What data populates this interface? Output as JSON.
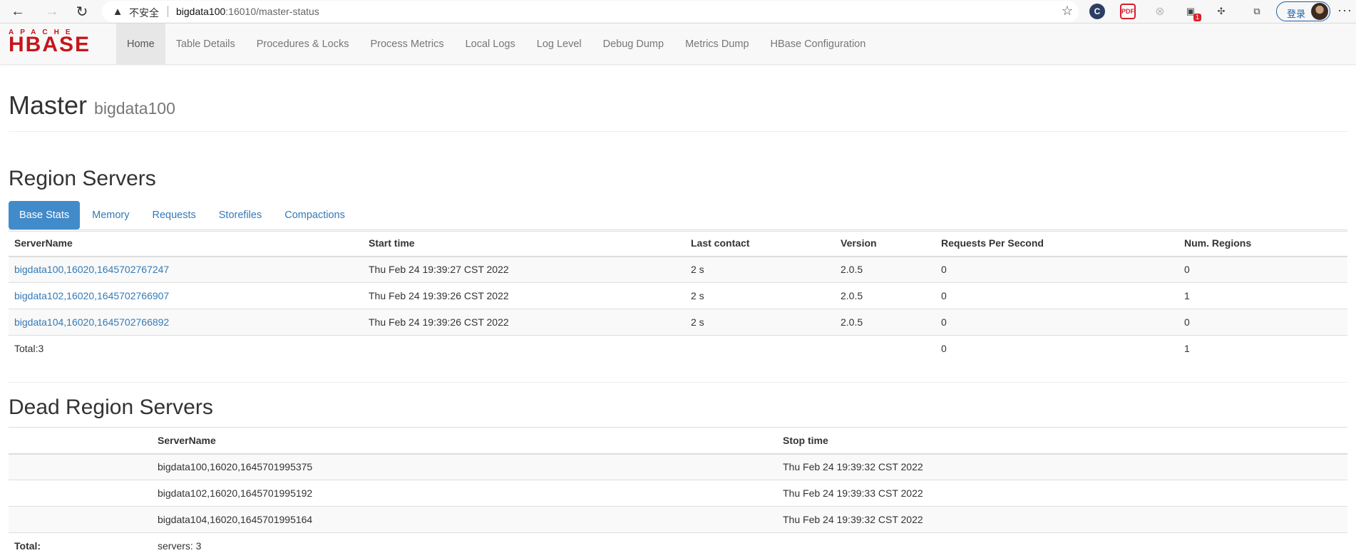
{
  "browser": {
    "insecure_label": "不安全",
    "url_host": "bigdata100",
    "url_rest": ":16010/master-status",
    "login_label": "登录",
    "more_label": "···",
    "extensions": [
      {
        "name": "c-extension-icon",
        "glyph": "C"
      },
      {
        "name": "pdf-extension-icon",
        "glyph": "PDF"
      },
      {
        "name": "gray-extension-icon",
        "glyph": "⊗"
      },
      {
        "name": "clipboard-extension-icon",
        "glyph": "▣",
        "badge": "1"
      },
      {
        "name": "puzzle-extensions-icon",
        "glyph": "✣"
      },
      {
        "name": "collections-icon",
        "glyph": "⧉"
      }
    ]
  },
  "logo": {
    "apache": "APACHE",
    "hbase": "HBASE"
  },
  "nav": {
    "items": [
      "Home",
      "Table Details",
      "Procedures & Locks",
      "Process Metrics",
      "Local Logs",
      "Log Level",
      "Debug Dump",
      "Metrics Dump",
      "HBase Configuration"
    ],
    "active": 0
  },
  "header": {
    "title": "Master",
    "subtitle": "bigdata100"
  },
  "region_servers": {
    "title": "Region Servers",
    "tabs": [
      "Base Stats",
      "Memory",
      "Requests",
      "Storefiles",
      "Compactions"
    ],
    "active_tab": 0,
    "columns": [
      "ServerName",
      "Start time",
      "Last contact",
      "Version",
      "Requests Per Second",
      "Num. Regions"
    ],
    "rows": [
      [
        "bigdata100,16020,1645702767247",
        "Thu Feb 24 19:39:27 CST 2022",
        "2 s",
        "2.0.5",
        "0",
        "0"
      ],
      [
        "bigdata102,16020,1645702766907",
        "Thu Feb 24 19:39:26 CST 2022",
        "2 s",
        "2.0.5",
        "0",
        "1"
      ],
      [
        "bigdata104,16020,1645702766892",
        "Thu Feb 24 19:39:26 CST 2022",
        "2 s",
        "2.0.5",
        "0",
        "0"
      ]
    ],
    "total": [
      "Total:3",
      "",
      "",
      "",
      "0",
      "1"
    ]
  },
  "dead_region_servers": {
    "title": "Dead Region Servers",
    "columns": [
      "",
      "ServerName",
      "Stop time"
    ],
    "rows": [
      [
        "",
        "bigdata100,16020,1645701995375",
        "Thu Feb 24 19:39:32 CST 2022"
      ],
      [
        "",
        "bigdata102,16020,1645701995192",
        "Thu Feb 24 19:39:33 CST 2022"
      ],
      [
        "",
        "bigdata104,16020,1645701995164",
        "Thu Feb 24 19:39:32 CST 2022"
      ]
    ],
    "total": [
      "Total:",
      "servers: 3",
      ""
    ]
  }
}
